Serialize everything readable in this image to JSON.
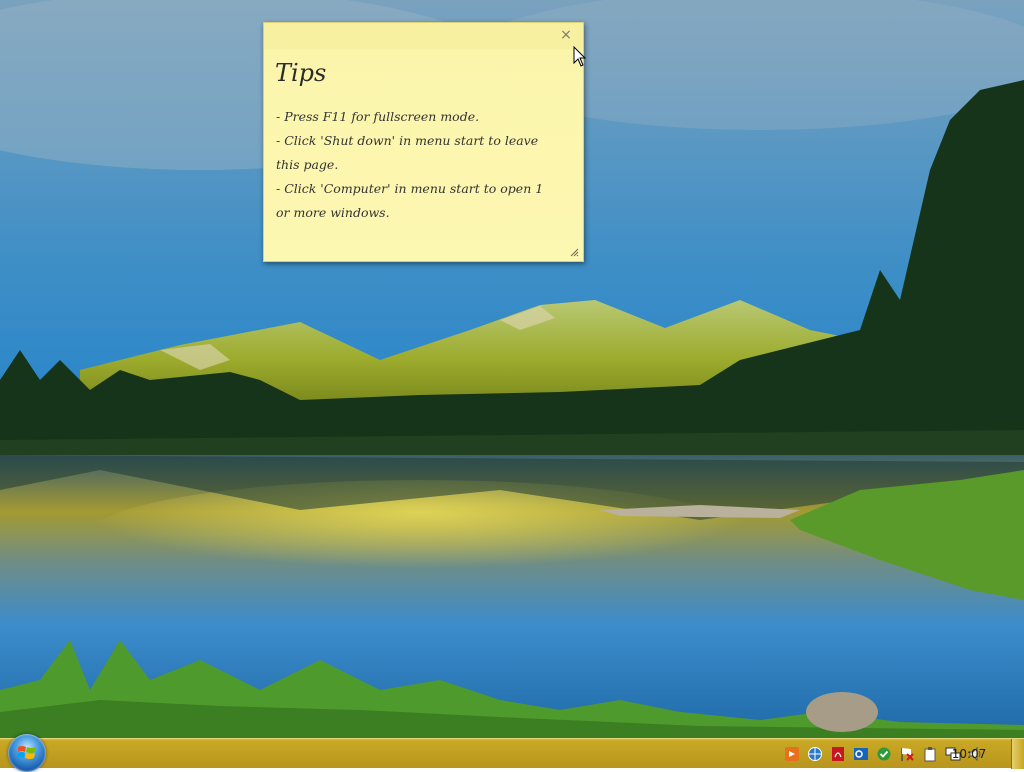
{
  "note": {
    "title": "Tips",
    "close_glyph": "×",
    "lines": [
      "- Press F11 for fullscreen mode.",
      "- Click 'Shut down' in menu start to leave",
      "this page.",
      "- Click 'Computer' in menu start to open 1",
      "or more windows."
    ]
  },
  "taskbar": {
    "clock": "10:07",
    "tray_icons": [
      "media-player-icon",
      "network-globe-icon",
      "pdf-reader-icon",
      "outlook-icon",
      "security-check-icon",
      "action-center-flag-icon",
      "clipboard-icon",
      "display-network-icon",
      "volume-icon"
    ]
  },
  "colors": {
    "note_bg": "#fcf7b1",
    "taskbar": "#c9a825"
  }
}
